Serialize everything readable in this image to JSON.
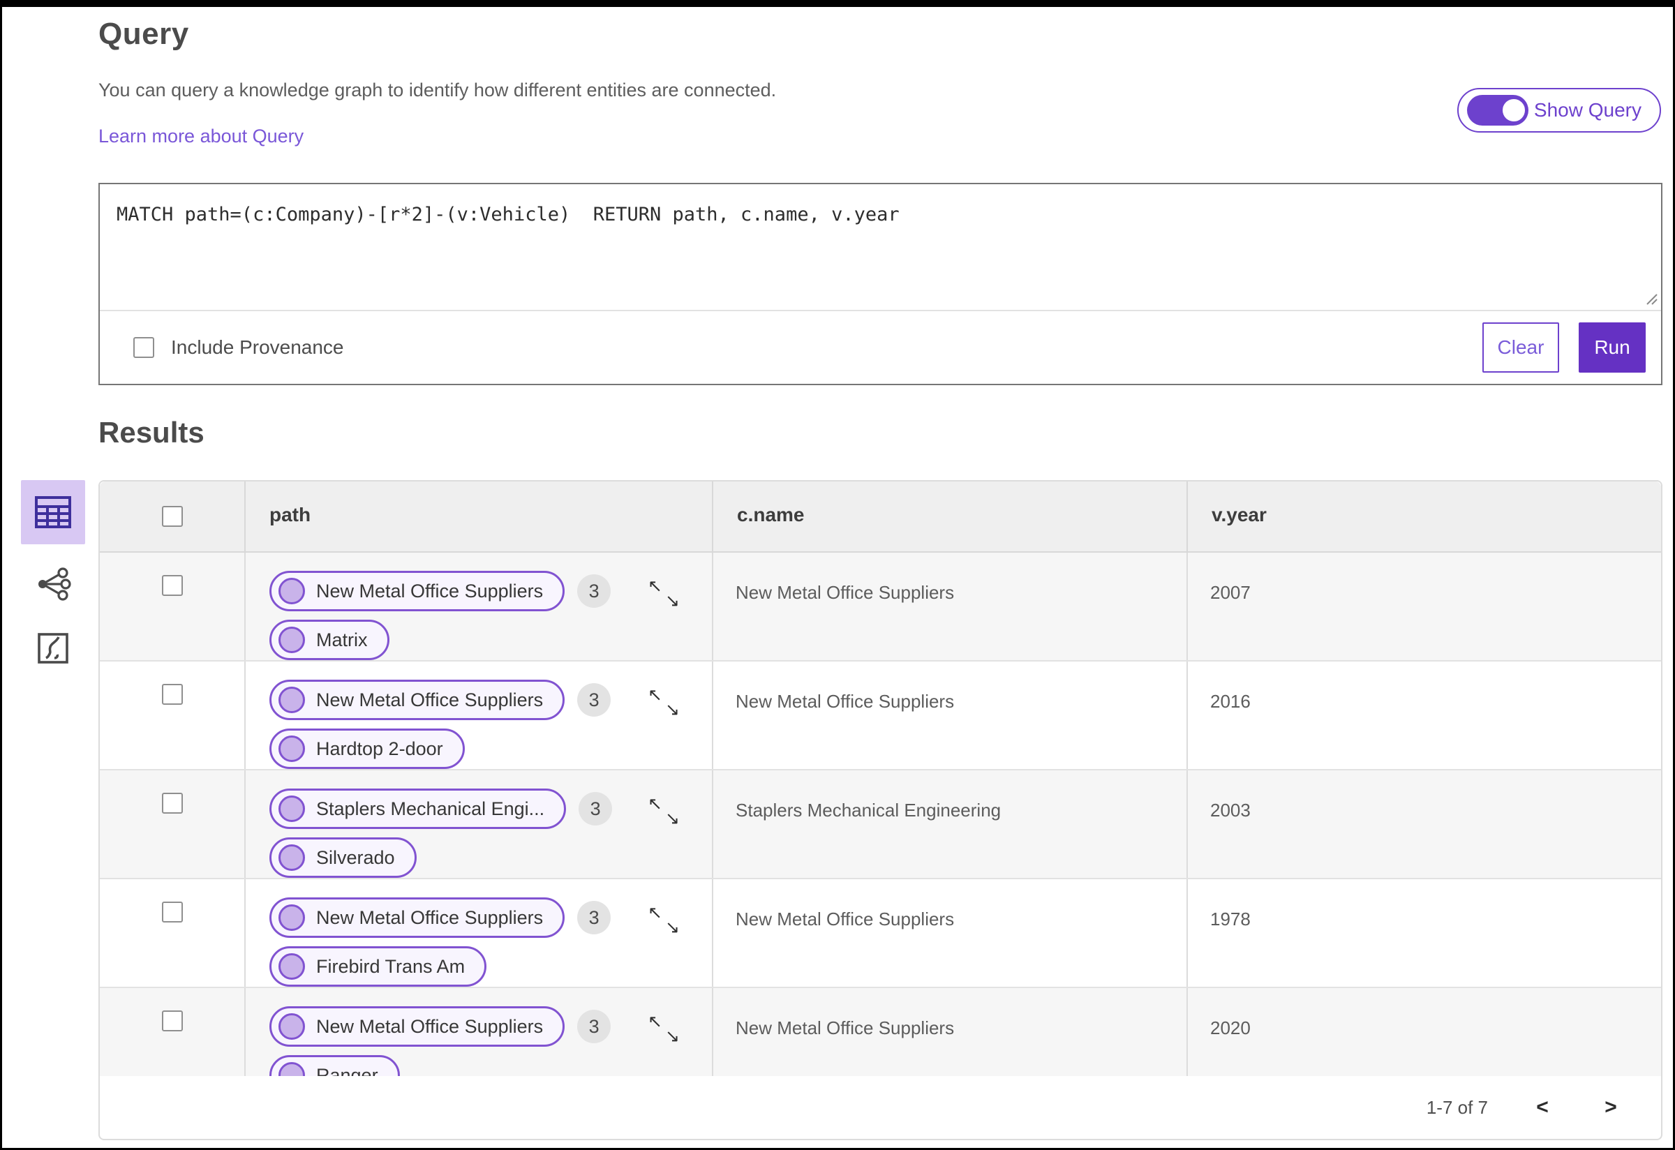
{
  "page": {
    "title": "Query",
    "description": "You can query a knowledge graph to identify how different entities are connected.",
    "learn_more_link": "Learn more about Query",
    "show_query_label": "Show Query",
    "query_text": "MATCH path=(c:Company)-[r*2]-(v:Vehicle)  RETURN path, c.name, v.year",
    "include_provenance_label": "Include Provenance",
    "clear_label": "Clear",
    "run_label": "Run",
    "results_title": "Results"
  },
  "sidebar": {
    "items": [
      {
        "name": "table-view",
        "icon": "table-icon",
        "selected": true
      },
      {
        "name": "graph-view",
        "icon": "network-icon",
        "selected": false
      },
      {
        "name": "map-view",
        "icon": "route-box-icon",
        "selected": false
      }
    ]
  },
  "icons": {
    "expand_nw": "↖",
    "expand_se": "↘",
    "prev": "<",
    "next": ">"
  },
  "table": {
    "columns": [
      "path",
      "c.name",
      "v.year"
    ],
    "rows": [
      {
        "path_nodes": [
          "New Metal Office Suppliers",
          "Matrix"
        ],
        "badge": "3",
        "c_name": "New Metal Office Suppliers",
        "v_year": "2007"
      },
      {
        "path_nodes": [
          "New Metal Office Suppliers",
          "Hardtop 2-door"
        ],
        "badge": "3",
        "c_name": "New Metal Office Suppliers",
        "v_year": "2016"
      },
      {
        "path_nodes": [
          "Staplers Mechanical Engi...",
          "Silverado"
        ],
        "badge": "3",
        "c_name": "Staplers Mechanical Engineering",
        "v_year": "2003"
      },
      {
        "path_nodes": [
          "New Metal Office Suppliers",
          "Firebird Trans Am"
        ],
        "badge": "3",
        "c_name": "New Metal Office Suppliers",
        "v_year": "1978"
      },
      {
        "path_nodes": [
          "New Metal Office Suppliers",
          "Ranger"
        ],
        "badge": "3",
        "c_name": "New Metal Office Suppliers",
        "v_year": "2020"
      }
    ],
    "pagination": {
      "range_label": "1-7 of 7"
    }
  },
  "colors": {
    "accent_purple": "#6d41cd",
    "run_button": "#6531c3",
    "link_purple": "#7a57d8",
    "pill_border": "#8153d1",
    "pill_bg": "#f8f5fe",
    "node_fill": "#c9b3ea",
    "badge_bg": "#e3e3e3",
    "header_bg": "#efefef",
    "row_alt_bg": "#f6f6f6",
    "sidebar_selected_bg": "#d8c8f3",
    "sidebar_icon": "#3e2f9c",
    "frame_border": "#000000"
  }
}
